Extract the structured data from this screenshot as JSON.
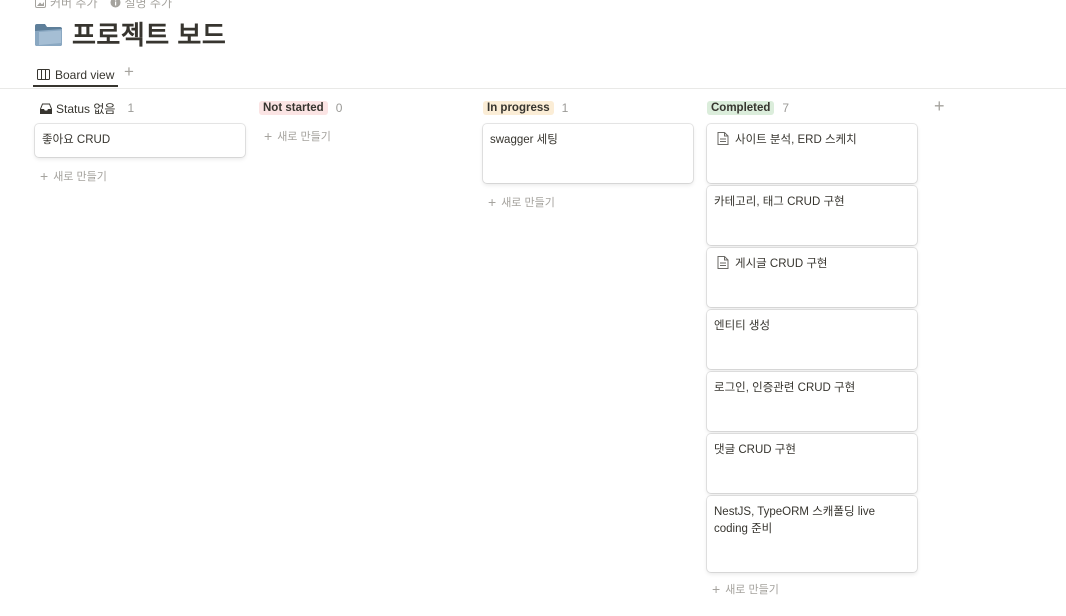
{
  "top_actions": {
    "add_cover": "커버 추가",
    "add_description": "설명 추가"
  },
  "page": {
    "icon": "folder-icon",
    "title": "프로젝트 보드"
  },
  "view": {
    "tab_label": "Board view",
    "add": "+"
  },
  "colors": {
    "not_started_bg": "#fbe4e4",
    "in_progress_bg": "#fbedd6",
    "completed_bg": "#dbeddb",
    "accent_text": "#37352f",
    "muted": "#a5a39e"
  },
  "columns": [
    {
      "name": "Status 없음",
      "count": "1",
      "cards": [
        "좋아요 CRUD"
      ],
      "new_label": "새로 만들기"
    },
    {
      "name": "Not started",
      "count": "0",
      "cards": [],
      "new_label": "새로 만들기"
    },
    {
      "name": "In progress",
      "count": "1",
      "cards": [
        "swagger 세팅"
      ],
      "new_label": "새로 만들기"
    },
    {
      "name": "Completed",
      "count": "7",
      "cards": [
        "사이트 분석, ERD 스케치",
        "카테고리, 태그 CRUD 구현",
        "게시글 CRUD 구현",
        "엔티티 생성",
        "로그인, 인증관련 CRUD 구현",
        "댓글 CRUD 구현",
        "NestJS, TypeORM 스캐폴딩 live coding 준비"
      ],
      "new_label": "새로 만들기"
    }
  ],
  "add_group": "+"
}
